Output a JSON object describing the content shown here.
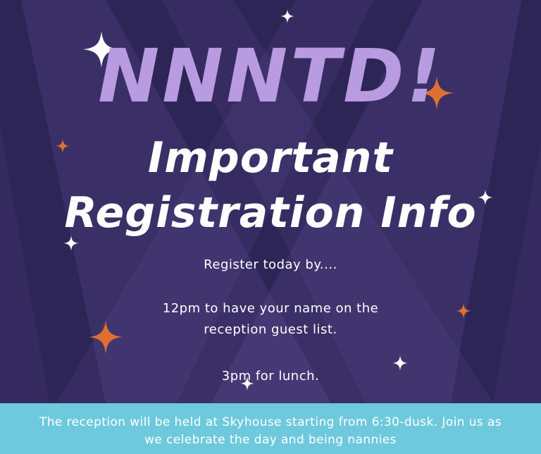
{
  "headline": {
    "acronym": "NNNTD!",
    "line1": "Important",
    "line2": "Registration Info"
  },
  "body": {
    "line1": "Register today by....",
    "line2": "12pm to have your name on the",
    "line3": "reception guest list.",
    "line4": "3pm for lunch."
  },
  "banner": {
    "line1": "The reception will be held at Skyhouse starting from 6:30-dusk. Join us as",
    "line2": "we celebrate the day and being nannies"
  },
  "colors": {
    "background": "#2e2557",
    "spotlight": "#6a5aa3",
    "acronym": "#b89be0",
    "banner": "#6ec9dd",
    "sparkle_white": "#ffffff",
    "sparkle_orange": "#e07030"
  },
  "icons": {
    "sparkle_white": "four-point-star-white-icon",
    "sparkle_orange": "four-point-star-orange-icon"
  }
}
